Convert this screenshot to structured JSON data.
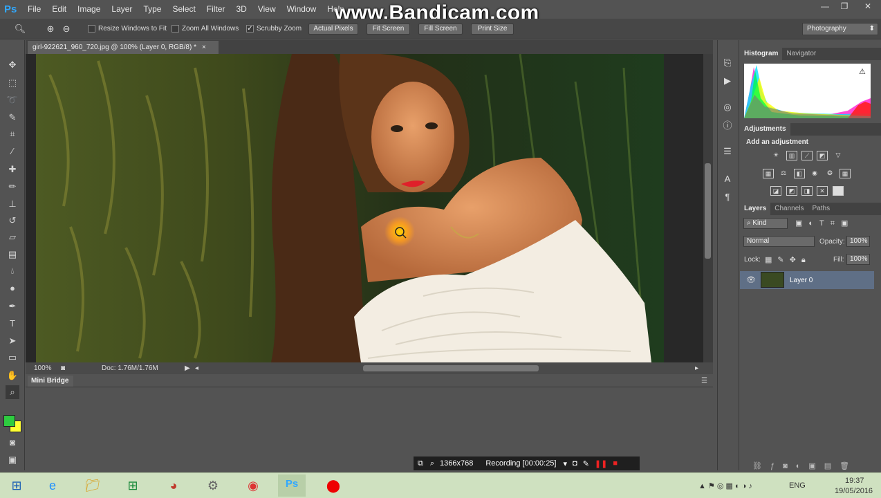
{
  "app": {
    "logo": "Ps",
    "watermark": "www.Bandicam.com"
  },
  "menu": [
    "File",
    "Edit",
    "Image",
    "Layer",
    "Type",
    "Select",
    "Filter",
    "3D",
    "View",
    "Window",
    "Help"
  ],
  "window_buttons": {
    "minimize": "—",
    "restore": "❐",
    "close": "✕"
  },
  "options_bar": {
    "resize_windows": "Resize Windows to Fit",
    "zoom_all": "Zoom All Windows",
    "scrubby_zoom": "Scrubby Zoom",
    "actual_pixels": "Actual Pixels",
    "fit_screen": "Fit Screen",
    "fill_screen": "Fill Screen",
    "print_size": "Print Size",
    "workspace": "Photography",
    "scrubby_checked": true
  },
  "document": {
    "tab_title": "girl-922621_960_720.jpg @ 100% (Layer 0, RGB/8) *",
    "zoom": "100%",
    "doc_size": "Doc: 1.76M/1.76M"
  },
  "mini_bridge": {
    "label": "Mini Bridge"
  },
  "recording": {
    "resolution": "1366x768",
    "status": "Recording [00:00:25]"
  },
  "panels": {
    "histogram_tab": "Histogram",
    "navigator_tab": "Navigator",
    "adjustments_tab": "Adjustments",
    "add_adjustment": "Add an adjustment",
    "layers_tab": "Layers",
    "channels_tab": "Channels",
    "paths_tab": "Paths",
    "kind": "Kind",
    "blend_mode": "Normal",
    "opacity_label": "Opacity:",
    "opacity": "100%",
    "lock_label": "Lock:",
    "fill_label": "Fill:",
    "fill": "100%",
    "layer_name": "Layer 0"
  },
  "taskbar": {
    "language": "ENG",
    "time": "19:37",
    "date": "19/05/2016"
  },
  "colors": {
    "foreground": "#2ecc40",
    "background": "#ffff33",
    "taskbar": "#cfe1c0",
    "selected_layer": "#5f6f86"
  }
}
